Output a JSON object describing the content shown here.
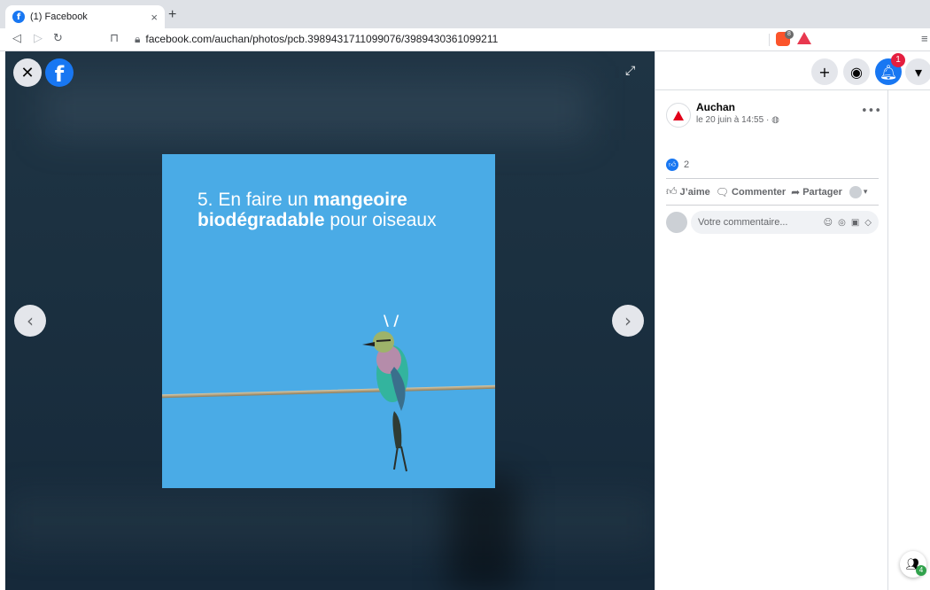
{
  "browser": {
    "tab_title": "(1) Facebook",
    "tab_close": "×",
    "new_tab": "+",
    "url": "facebook.com/auchan/photos/pcb.3989431711099076/3989430361099211",
    "brave_badge": "8",
    "back_icon": "back-icon",
    "forward_icon": "forward-icon",
    "reload_icon": "reload-icon"
  },
  "viewer": {
    "caption_line1_regular": "5. En faire un ",
    "caption_line1_bold": "mangeoire",
    "caption_line2_bold": "biodégradable",
    "caption_line2_regular": " pour oiseaux",
    "photo_bg": "#4aabe6"
  },
  "header": {
    "notifications_count": "1",
    "icons": [
      "plus-icon",
      "messenger-icon",
      "bell-icon",
      "caret-down-icon"
    ]
  },
  "post": {
    "page_name": "Auchan",
    "date": "le 20 juin à 14:55 · ",
    "likes_count": "2",
    "actions": {
      "like": "J’aime",
      "comment": "Commenter",
      "share": "Partager"
    },
    "comment_placeholder": "Votre commentaire..."
  },
  "contacts": {
    "online_count": "4"
  },
  "colors": {
    "facebook_blue": "#1877f2",
    "notification_red": "#e41e3f",
    "viewer_bg": "#1b3040"
  }
}
